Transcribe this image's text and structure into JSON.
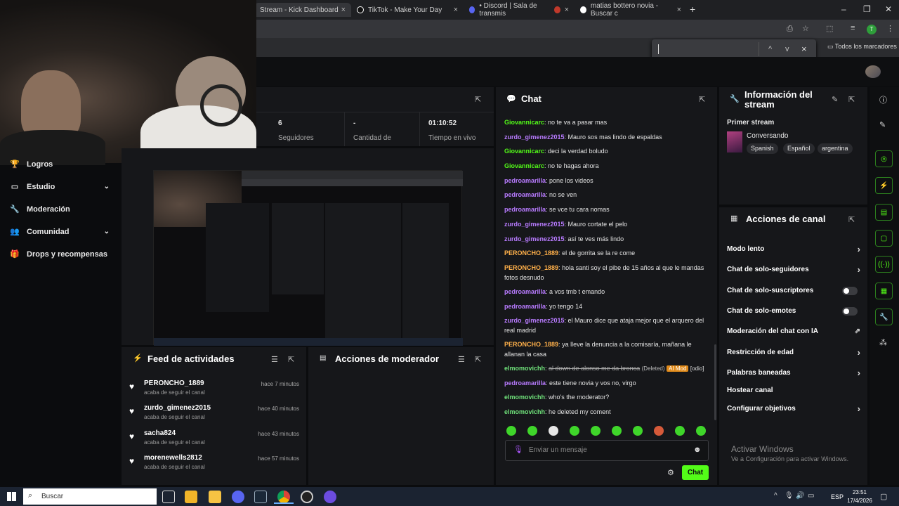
{
  "browser": {
    "tabs": [
      {
        "title": "Stream - Kick Dashboard",
        "active": true
      },
      {
        "title": "TikTok - Make Your Day",
        "active": false
      },
      {
        "title": "• Discord | Sala de transmis",
        "active": false
      },
      {
        "title": "matias bottero novia - Buscar c",
        "active": false
      }
    ],
    "new_tab": "+",
    "bookmarks_label": "Todos los marcadores",
    "find_up": "^",
    "find_down": "v",
    "find_close": "×"
  },
  "sidebar": {
    "items": [
      {
        "label": "Logros",
        "icon": "trophy-icon",
        "chevron": false
      },
      {
        "label": "Estudio",
        "icon": "monitor-icon",
        "chevron": true
      },
      {
        "label": "Moderación",
        "icon": "wrench-icon",
        "chevron": false
      },
      {
        "label": "Comunidad",
        "icon": "people-icon",
        "chevron": true
      },
      {
        "label": "Drops y recompensas",
        "icon": "gift-icon",
        "chevron": false
      }
    ]
  },
  "stats": {
    "followers_value": "6",
    "followers_label": "Seguidores",
    "count_value": "-",
    "count_label": "Cantidad de",
    "live_value": "01:10:52",
    "live_label": "Tiempo en vivo"
  },
  "activity_feed": {
    "title": "Feed de actividades",
    "items": [
      {
        "name": "PERONCHO_1889",
        "sub": "acaba de seguir el canal",
        "time": "hace 7 minutos"
      },
      {
        "name": "zurdo_gimenez2015",
        "sub": "acaba de seguir el canal",
        "time": "hace 40 minutos"
      },
      {
        "name": "sacha824",
        "sub": "acaba de seguir el canal",
        "time": "hace 43 minutos"
      },
      {
        "name": "morenewells2812",
        "sub": "acaba de seguir el canal",
        "time": "hace 57 minutos"
      }
    ]
  },
  "mod_actions": {
    "title": "Acciones de moderador"
  },
  "chat": {
    "title": "Chat",
    "messages": [
      {
        "user": "Giovannicarc",
        "color": "green",
        "text": "no te va a pasar mas"
      },
      {
        "user": "zurdo_gimenez2015",
        "color": "purple",
        "text": "Mauro sos mas lindo de espaldas"
      },
      {
        "user": "Giovannicarc",
        "color": "green",
        "text": "deci la verdad boludo"
      },
      {
        "user": "Giovannicarc",
        "color": "green",
        "text": "no te hagas ahora"
      },
      {
        "user": "pedroamarilla",
        "color": "purple",
        "text": "pone los videos"
      },
      {
        "user": "pedroamarilla",
        "color": "purple",
        "text": "no se ven"
      },
      {
        "user": "pedroamarilla",
        "color": "purple",
        "text": "se vce tu cara nomas"
      },
      {
        "user": "zurdo_gimenez2015",
        "color": "purple",
        "text": "Mauro cortate el pelo"
      },
      {
        "user": "zurdo_gimenez2015",
        "color": "purple",
        "text": "así te ves más lindo"
      },
      {
        "user": "PERONCHO_1889",
        "color": "orange",
        "text": "el de gorrita se la re come"
      },
      {
        "user": "PERONCHO_1889",
        "color": "orange",
        "text": "hola santi soy el pibe de 15 años al que le mandas fotos desnudo"
      },
      {
        "user": "pedroamarilla",
        "color": "purple",
        "text": "a vos tmb t emando"
      },
      {
        "user": "pedroamarilla",
        "color": "purple",
        "text": "yo tengo 14"
      },
      {
        "user": "zurdo_gimenez2015",
        "color": "purple",
        "text": "el Mauro dice que ataja mejor que el arquero del real madrid"
      },
      {
        "user": "PERONCHO_1889",
        "color": "orange",
        "text": "ya lleve la denuncia a la comisaría, mañana le allanan la casa"
      },
      {
        "user": "elmomovichh",
        "color": "grey",
        "text": "al down de alonso me da bronca",
        "deleted": "(Deleted)",
        "badge": "AI Mod",
        "tag": "[odio]"
      },
      {
        "user": "pedroamarilla",
        "color": "purple",
        "text": "este tiene novia y vos no, virgo"
      },
      {
        "user": "elmomovichh",
        "color": "grey",
        "text": "who's the moderator?"
      },
      {
        "user": "elmomovichh",
        "color": "grey",
        "text": "he deleted my coment"
      }
    ],
    "input_placeholder": "Enviar un mensaje",
    "send_label": "Chat"
  },
  "stream_info": {
    "title": "Información del stream",
    "stream_title": "Primer stream",
    "category": "Conversando",
    "tags": [
      "Spanish",
      "Español",
      "argentina"
    ]
  },
  "channel_actions": {
    "title": "Acciones de canal",
    "items": [
      {
        "label": "Modo lento",
        "type": "arrow"
      },
      {
        "label": "Chat de solo-seguidores",
        "type": "arrow"
      },
      {
        "label": "Chat de solo-suscriptores",
        "type": "toggle"
      },
      {
        "label": "Chat de solo-emotes",
        "type": "toggle"
      },
      {
        "label": "Moderación del chat con IA",
        "type": "external"
      },
      {
        "label": "Restricción de edad",
        "type": "arrow"
      },
      {
        "label": "Palabras baneadas",
        "type": "arrow"
      },
      {
        "label": "Hostear canal",
        "type": "none"
      },
      {
        "label": "Configurar objetivos",
        "type": "arrow"
      }
    ]
  },
  "watermark": {
    "line1": "Activar Windows",
    "line2": "Ve a Configuración para activar Windows."
  },
  "taskbar": {
    "search_label": "Buscar",
    "lang": "ESP",
    "time": "23:51",
    "date": "17/4/2026"
  },
  "colors": {
    "kick_green": "#53fc18",
    "panel_bg": "#16171a",
    "page_bg": "#0b0c0e"
  }
}
